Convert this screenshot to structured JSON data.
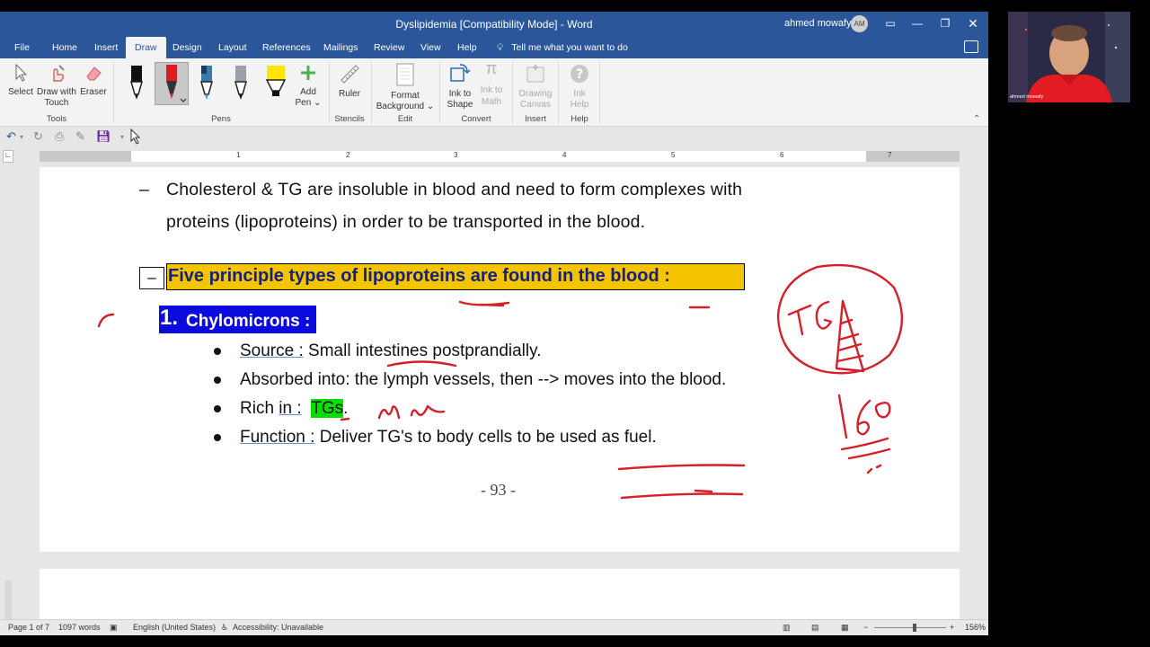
{
  "window": {
    "title": "Dyslipidemia [Compatibility Mode]  -  Word",
    "user_name": "ahmed mowafy",
    "user_initials": "AM"
  },
  "tabs": [
    "File",
    "Home",
    "Insert",
    "Draw",
    "Design",
    "Layout",
    "References",
    "Mailings",
    "Review",
    "View",
    "Help"
  ],
  "active_tab": "Draw",
  "tell_me": "Tell me what you want to do",
  "ribbon": {
    "tools": {
      "select": "Select",
      "draw_touch_1": "Draw with",
      "draw_touch_2": "Touch",
      "eraser": "Eraser",
      "group": "Tools"
    },
    "pens_group": "Pens",
    "add_pen_1": "Add",
    "add_pen_2": "Pen ⌄",
    "ruler": "Ruler",
    "stencils_group": "Stencils",
    "format_bg_1": "Format",
    "format_bg_2": "Background ⌄",
    "edit_group": "Edit",
    "ink_shape_1": "Ink to",
    "ink_shape_2": "Shape",
    "ink_math_1": "Ink to",
    "ink_math_2": "Math",
    "convert_group": "Convert",
    "drawing_canvas_1": "Drawing",
    "drawing_canvas_2": "Canvas",
    "insert_group": "Insert",
    "ink_help_1": "Ink",
    "ink_help_2": "Help",
    "help_group": "Help"
  },
  "ruler_numbers": [
    "1",
    "2",
    "3",
    "4",
    "5",
    "6",
    "7"
  ],
  "document": {
    "dash": "–",
    "line1": "Cholesterol & TG are insoluble in blood and need to form complexes with",
    "line2": "proteins (lipoproteins) in order to be transported in the blood.",
    "headline": "Five principle types of lipoproteins are found in the blood :",
    "chylo_num": "1.",
    "chylo_label": "Chylomicrons :",
    "b1_label": "Source :",
    "b1_text": " Small intestines postprandially.",
    "b2_text": "Absorbed into: the lymph vessels, then --> moves into the blood.",
    "b3_pre": "Rich ",
    "b3_in": "in :",
    "b3_tg": "TGs",
    "b3_post": ".",
    "b4_label": "Function :",
    "b4_text": "  Deliver TG's to body cells to be used as fuel.",
    "page_number": "- 93 -"
  },
  "ink": {
    "circle_text": "TG",
    "number": "160",
    "color": "#d4202a"
  },
  "status": {
    "page": "Page 1 of 7",
    "words": "1097 words",
    "language": "English (United States)",
    "accessibility": "Accessibility: Unavailable",
    "zoom": "156%"
  },
  "webcam": {
    "name": "ahmed mowafy"
  }
}
